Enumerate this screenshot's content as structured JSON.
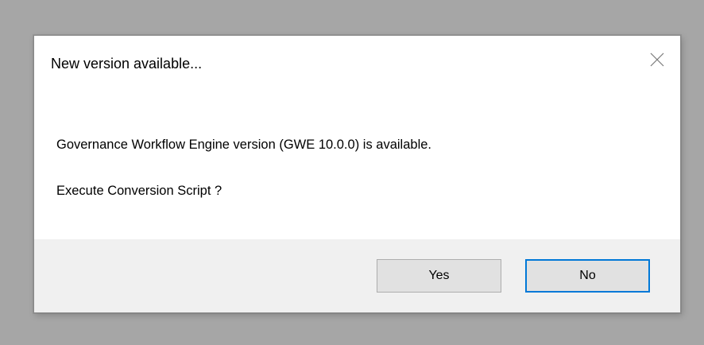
{
  "dialog": {
    "title": "New version available...",
    "close_icon": "close-icon",
    "messages": [
      "Governance Workflow Engine version (GWE 10.0.0) is available.",
      "Execute Conversion Script ?"
    ],
    "buttons": {
      "yes_label": "Yes",
      "no_label": "No"
    }
  },
  "colors": {
    "backdrop": "#a6a6a6",
    "dialog_background": "#ffffff",
    "footer_background": "#f0f0f0",
    "button_background": "#e1e1e1",
    "default_button_border": "#0078d7"
  }
}
